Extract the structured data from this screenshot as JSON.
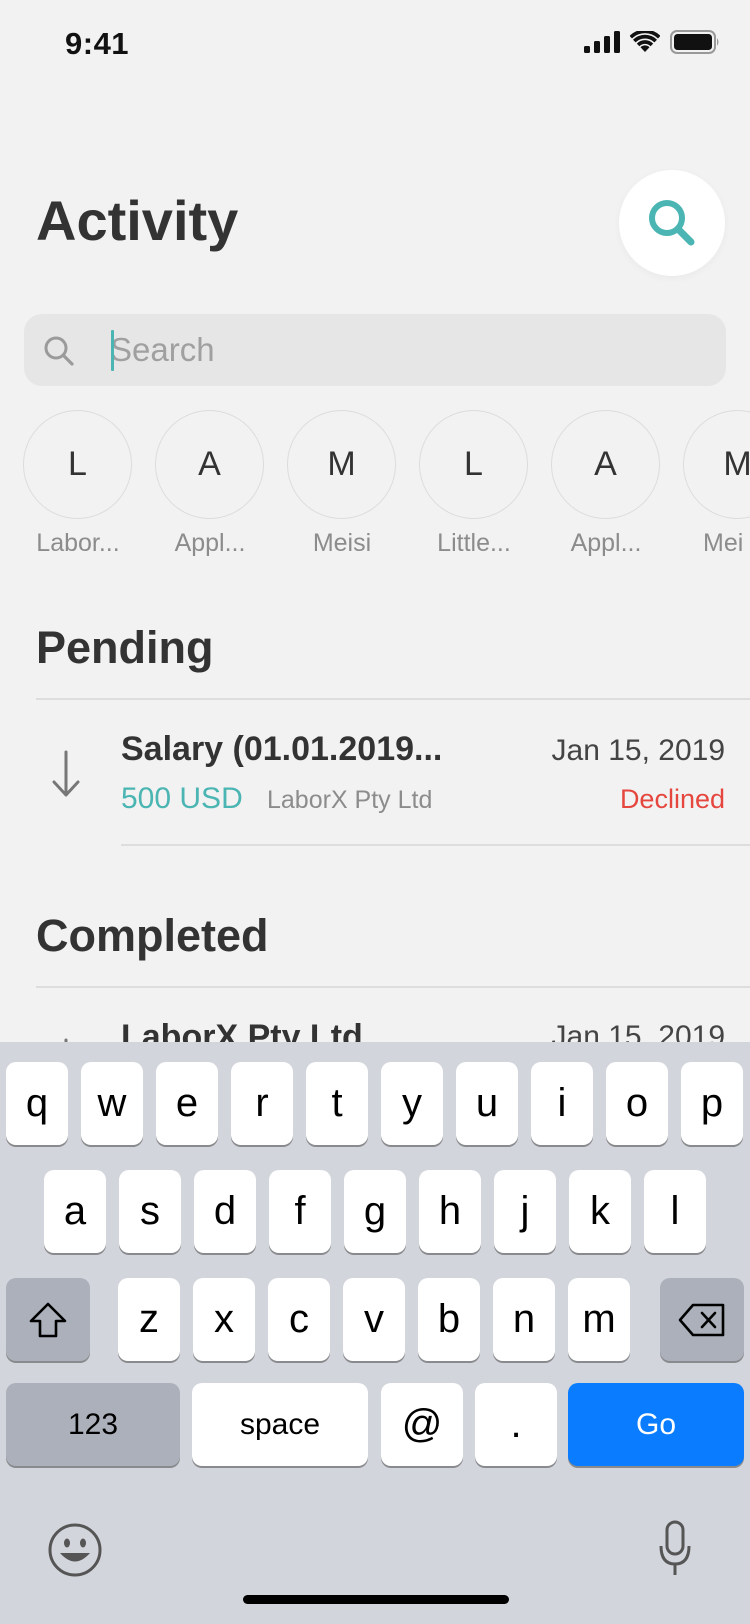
{
  "status_bar": {
    "time": "9:41"
  },
  "header": {
    "title": "Activity"
  },
  "search": {
    "placeholder": "Search",
    "value": ""
  },
  "contacts": [
    {
      "initial": "L",
      "name": "Labor..."
    },
    {
      "initial": "A",
      "name": "Appl..."
    },
    {
      "initial": "M",
      "name": "Meisi"
    },
    {
      "initial": "L",
      "name": "Little..."
    },
    {
      "initial": "A",
      "name": "Appl..."
    },
    {
      "initial": "M",
      "name": "Mei"
    }
  ],
  "pending": {
    "title": "Pending",
    "transactions": [
      {
        "title": "Salary (01.01.2019...",
        "amount": "500 USD",
        "counterparty": "LaborX Pty Ltd",
        "date": "Jan 15, 2019",
        "status": "Declined"
      }
    ]
  },
  "completed": {
    "title": "Completed",
    "transactions": [
      {
        "title": "LaborX Pty Ltd",
        "date": "Jan 15, 2019"
      }
    ]
  },
  "keyboard": {
    "row1": [
      "q",
      "w",
      "e",
      "r",
      "t",
      "y",
      "u",
      "i",
      "o",
      "p"
    ],
    "row2": [
      "a",
      "s",
      "d",
      "f",
      "g",
      "h",
      "j",
      "k",
      "l"
    ],
    "row3": [
      "z",
      "x",
      "c",
      "v",
      "b",
      "n",
      "m"
    ],
    "numbers_label": "123",
    "space_label": "space",
    "at_label": "@",
    "dot_label": ".",
    "go_label": "Go"
  },
  "colors": {
    "accent": "#4ab5b2",
    "declined": "#e5473f",
    "go_key": "#0a7cff",
    "background": "#f2f2f2"
  },
  "icons": {
    "fab": "search-icon",
    "search_field": "magnifier-icon",
    "tx_direction": "arrow-down-icon",
    "shift": "shift-icon",
    "backspace": "backspace-icon",
    "emoji": "emoji-icon",
    "dictation": "microphone-icon"
  }
}
